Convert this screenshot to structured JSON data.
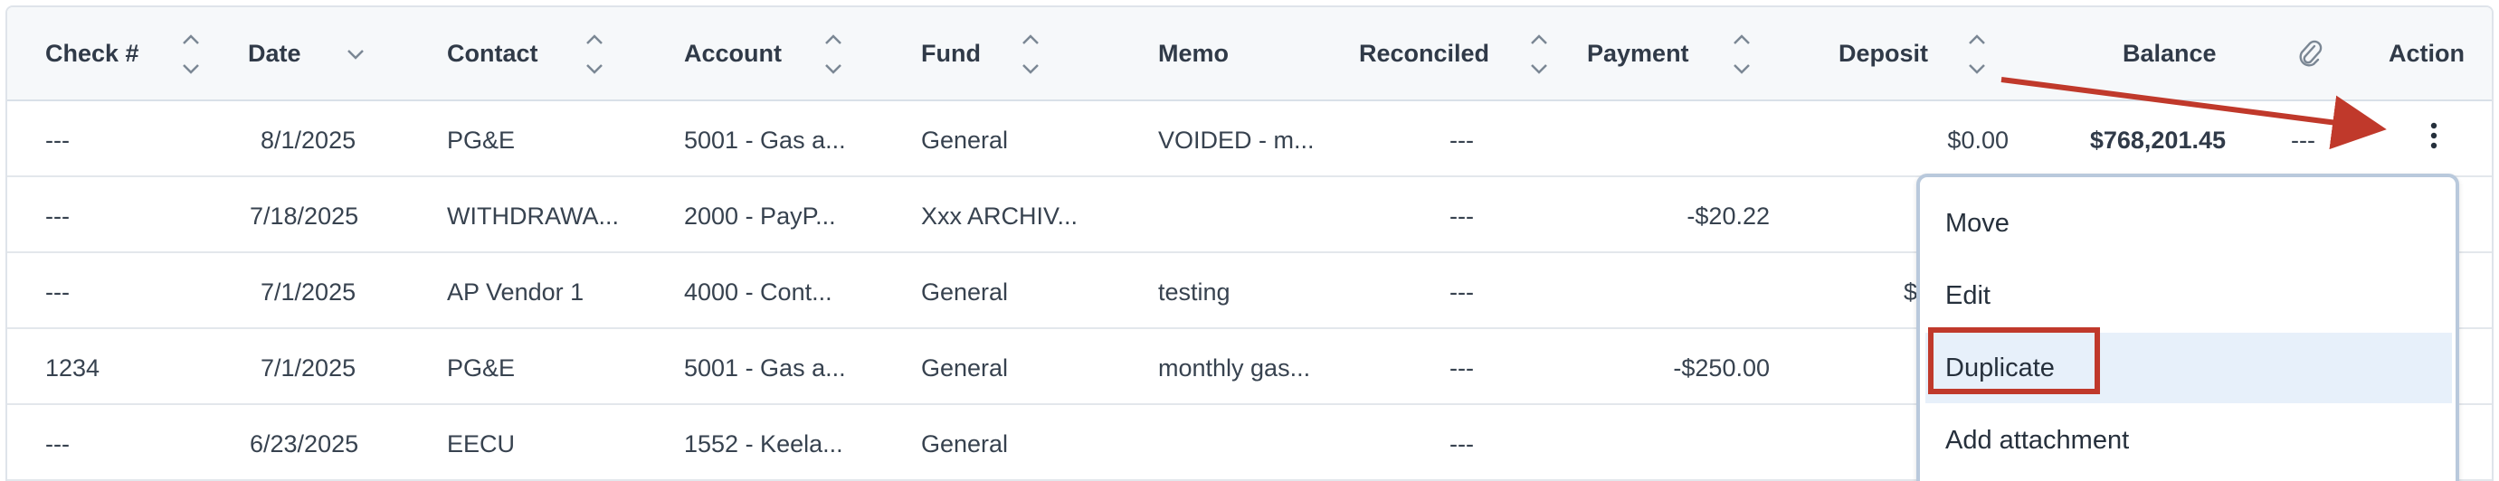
{
  "columns": {
    "check": "Check #",
    "date": "Date",
    "contact": "Contact",
    "account": "Account",
    "fund": "Fund",
    "memo": "Memo",
    "reconciled": "Reconciled",
    "payment": "Payment",
    "deposit": "Deposit",
    "balance": "Balance",
    "attachment_icon": "paperclip-icon",
    "action": "Action"
  },
  "rows": [
    {
      "check": "---",
      "date": "8/1/2025",
      "contact": "PG&E",
      "account": "5001 - Gas a...",
      "fund": "General",
      "memo": "VOIDED - m...",
      "reconciled": "---",
      "payment": "",
      "deposit": "$0.00",
      "balance": "$768,201.45",
      "attachment": "---"
    },
    {
      "check": "---",
      "date": "7/18/2025",
      "contact": "WITHDRAWA...",
      "account": "2000 - PayP...",
      "fund": "Xxx ARCHIV...",
      "memo": "",
      "reconciled": "---",
      "payment": "-$20.22",
      "deposit": "",
      "balance": "",
      "attachment": ""
    },
    {
      "check": "---",
      "date": "7/1/2025",
      "contact": "AP Vendor 1",
      "account": "4000 - Cont...",
      "fund": "General",
      "memo": "testing",
      "reconciled": "---",
      "payment": "",
      "deposit": "$",
      "balance": "",
      "attachment": ""
    },
    {
      "check": "1234",
      "date": "7/1/2025",
      "contact": "PG&E",
      "account": "5001 - Gas a...",
      "fund": "General",
      "memo": "monthly gas...",
      "reconciled": "---",
      "payment": "-$250.00",
      "deposit": "",
      "balance": "",
      "attachment": ""
    },
    {
      "check": "---",
      "date": "6/23/2025",
      "contact": "EECU",
      "account": "1552 - Keela...",
      "fund": "General",
      "memo": "",
      "reconciled": "---",
      "payment": "",
      "deposit": "",
      "balance": "",
      "attachment": ""
    }
  ],
  "menu": {
    "items": [
      "Move",
      "Edit",
      "Duplicate",
      "Add attachment"
    ],
    "active": "Duplicate"
  },
  "colors": {
    "annotation": "#c0392b",
    "menu_active": "#e7f0fa",
    "header_bg": "#f6f8fa"
  }
}
